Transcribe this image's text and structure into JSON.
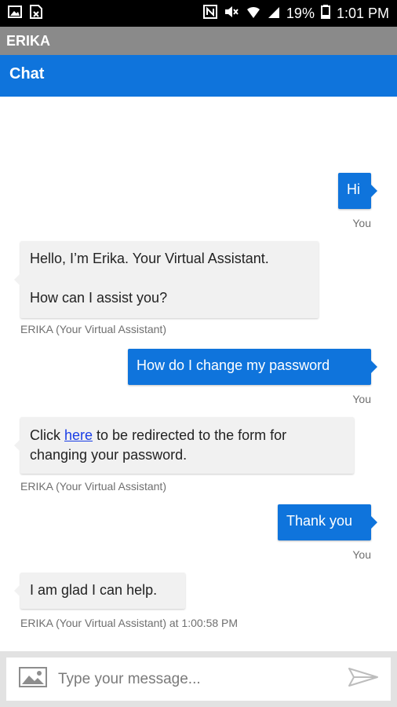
{
  "status_bar": {
    "battery_percent": "19%",
    "time": "1:01 PM"
  },
  "app_title": "ERIKA",
  "header": {
    "title": "Chat"
  },
  "messages": [
    {
      "sender": "user",
      "text": "Hi",
      "meta": "You"
    },
    {
      "sender": "bot",
      "line1": "Hello, I’m Erika. Your Virtual Assistant.",
      "line2": "How can I assist you?",
      "meta": "ERIKA (Your Virtual Assistant)"
    },
    {
      "sender": "user",
      "text": "How do I change my password",
      "meta": "You"
    },
    {
      "sender": "bot",
      "prefix": "Click ",
      "link": "here",
      "suffix": " to be redirected to the form for changing your password.",
      "meta": "ERIKA (Your Virtual Assistant)"
    },
    {
      "sender": "user",
      "text": "Thank you",
      "meta": "You"
    },
    {
      "sender": "bot",
      "text": "I am glad I can help.",
      "meta": "ERIKA (Your Virtual Assistant) at 1:00:58 PM"
    }
  ],
  "composer": {
    "placeholder": "Type your message..."
  },
  "icons": {
    "status_left": [
      "image-icon",
      "sim-card-icon"
    ],
    "status_right": [
      "nfc-icon",
      "mute-icon",
      "wifi-icon",
      "signal-icon",
      "battery-icon"
    ],
    "composer_left": "image-attach-icon",
    "composer_right": "send-icon"
  }
}
